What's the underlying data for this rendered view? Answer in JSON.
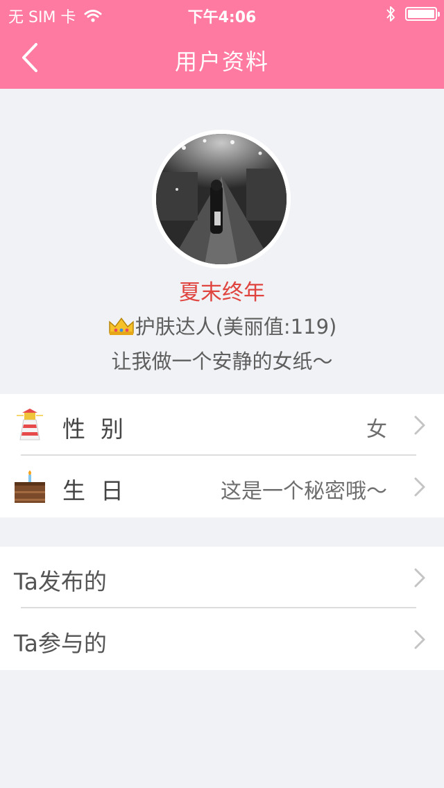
{
  "status_bar": {
    "carrier": "无 SIM 卡",
    "time": "下午4:06"
  },
  "nav": {
    "title": "用户资料"
  },
  "profile": {
    "nickname": "夏末终年",
    "level_icon": "crown-icon",
    "level_text": "护肤达人(美丽值:119)",
    "signature": "让我做一个安静的女纸～"
  },
  "info_rows": [
    {
      "icon": "lighthouse-icon",
      "label": "性别",
      "value": "女"
    },
    {
      "icon": "birthday-cake-icon",
      "label": "生日",
      "value": "这是一个秘密哦～"
    }
  ],
  "link_rows": [
    {
      "label": "Ta发布的"
    },
    {
      "label": "Ta参与的"
    }
  ],
  "colors": {
    "header": "#ff7aa0",
    "background": "#f0f2f5",
    "nickname": "#e0443f"
  }
}
